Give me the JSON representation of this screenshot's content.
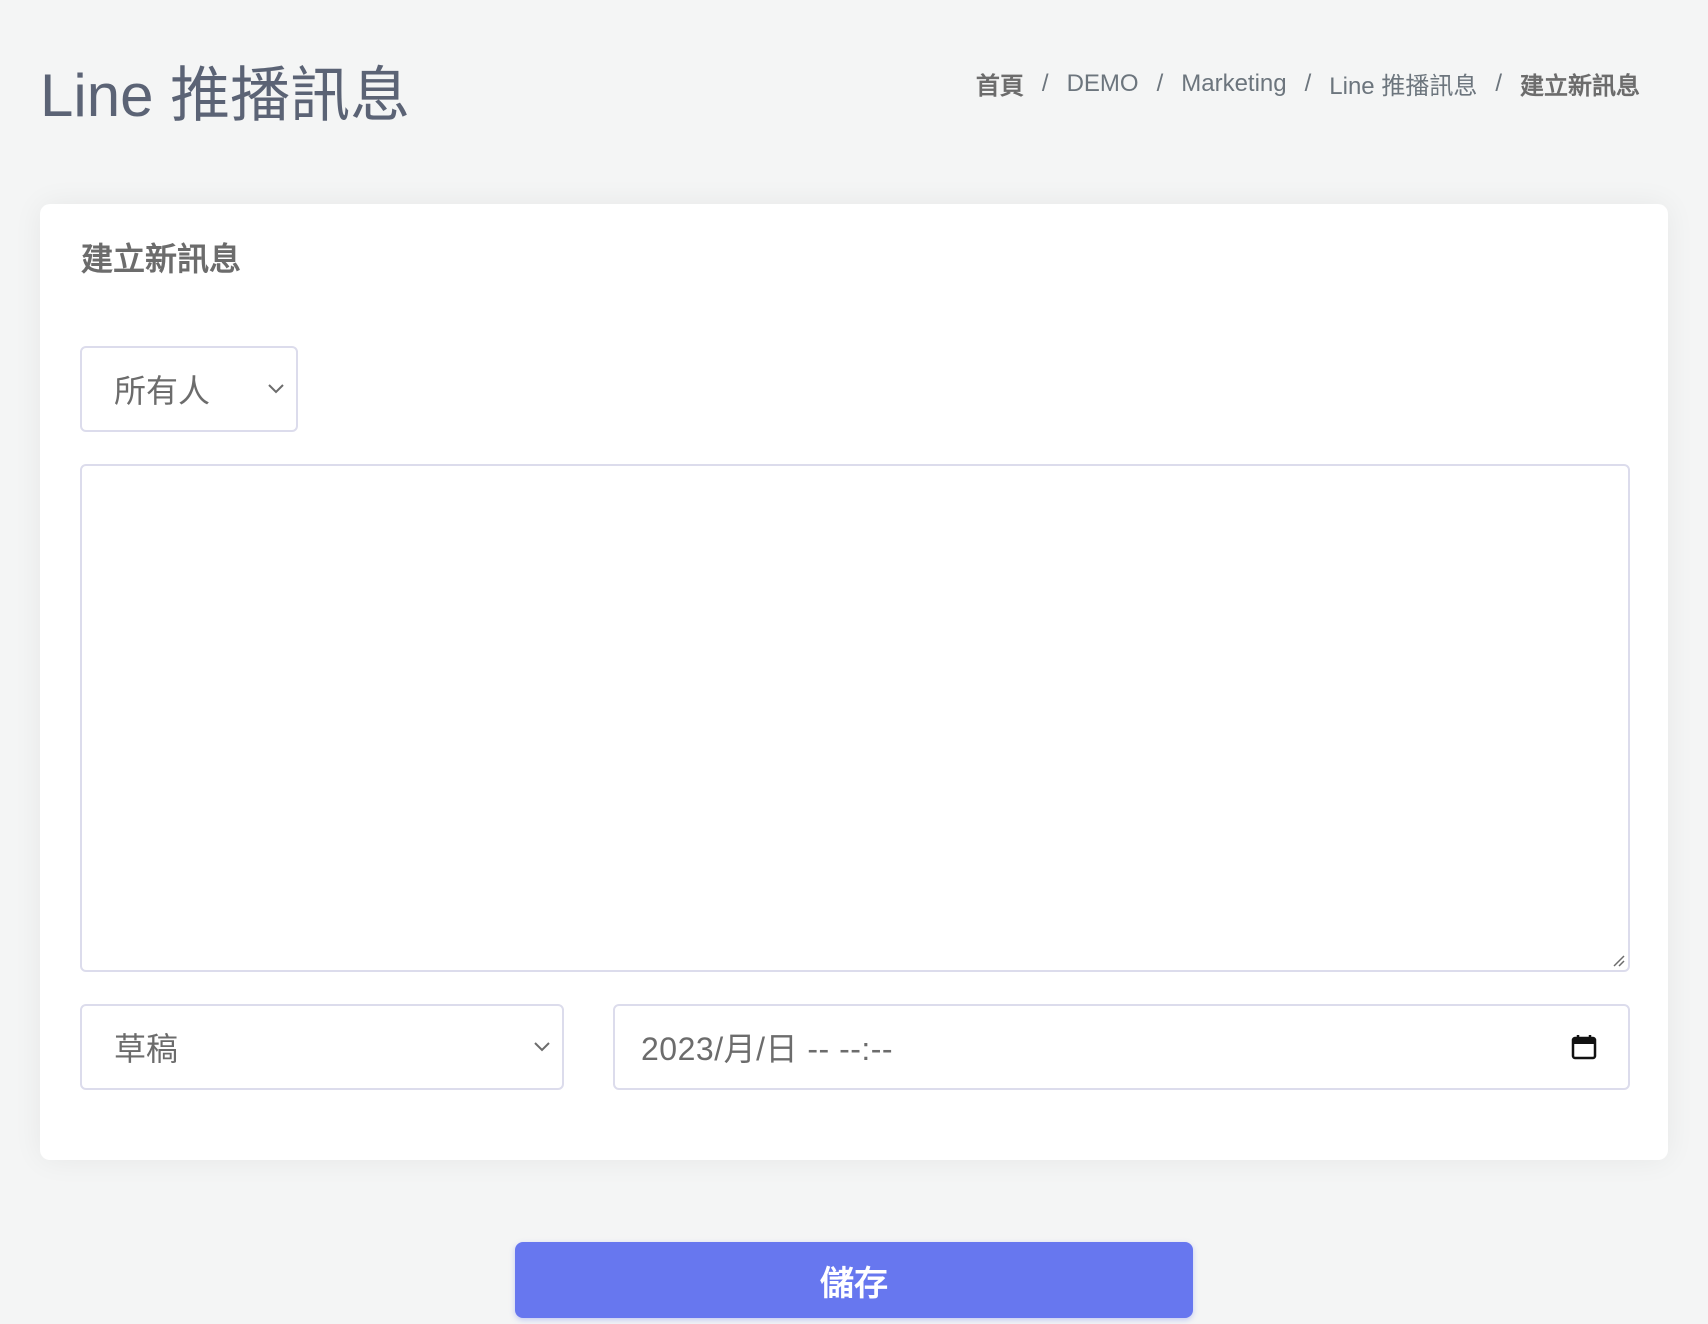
{
  "page": {
    "title": "Line 推播訊息"
  },
  "breadcrumb": {
    "items": [
      {
        "label": "首頁"
      },
      {
        "label": "DEMO"
      },
      {
        "label": "Marketing"
      },
      {
        "label": "Line 推播訊息"
      },
      {
        "label": "建立新訊息"
      }
    ],
    "separator": "/"
  },
  "form": {
    "card_title": "建立新訊息",
    "audience": {
      "selected": "所有人"
    },
    "message": {
      "value": "",
      "placeholder": ""
    },
    "status": {
      "selected": "草稿"
    },
    "schedule": {
      "display_value": "2023/月/日 -- --:--"
    },
    "save_label": "儲存"
  },
  "colors": {
    "accent": "#6777ef",
    "background": "#f4f5f5",
    "border": "#dcdcec",
    "text": "#6c6c6c"
  },
  "icons": {
    "select_chevron": "chevron-down-icon",
    "calendar": "calendar-icon",
    "resize": "resize-handle-icon"
  }
}
